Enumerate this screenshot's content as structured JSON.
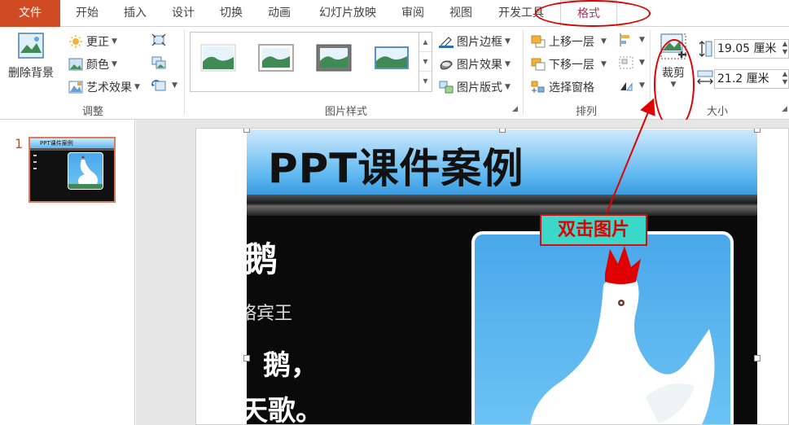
{
  "tabs": [
    {
      "id": "file",
      "label": "文件"
    },
    {
      "id": "home",
      "label": "开始"
    },
    {
      "id": "insert",
      "label": "插入"
    },
    {
      "id": "design",
      "label": "设计"
    },
    {
      "id": "transitions",
      "label": "切换"
    },
    {
      "id": "animations",
      "label": "动画"
    },
    {
      "id": "slideshow",
      "label": "幻灯片放映"
    },
    {
      "id": "review",
      "label": "审阅"
    },
    {
      "id": "view",
      "label": "视图"
    },
    {
      "id": "developer",
      "label": "开发工具"
    },
    {
      "id": "format",
      "label": "格式"
    }
  ],
  "ribbon": {
    "adjust": {
      "remove_bg": "删除背景",
      "corrections": "更正",
      "color": "颜色",
      "artistic": "艺术效果",
      "label": "调整"
    },
    "styles": {
      "border": "图片边框",
      "effects": "图片效果",
      "layout": "图片版式",
      "label": "图片样式"
    },
    "arrange": {
      "bring_forward": "上移一层",
      "send_backward": "下移一层",
      "selection_pane": "选择窗格",
      "label": "排列"
    },
    "size": {
      "crop": "裁剪",
      "height": "19.05 厘米",
      "width": "21.2 厘米",
      "label": "大小"
    }
  },
  "slides": {
    "number": "1",
    "thumb_title": "PPT课件案例"
  },
  "slide": {
    "title": "PPT课件案例",
    "poem_title": "鹅",
    "author": "骆宾王",
    "line1": "，鹅，",
    "line2": "天歌。"
  },
  "annotation": {
    "callout": "双击图片"
  },
  "colors": {
    "file_tab": "#d04a24",
    "format_tab_text": "#b0305a",
    "annotation_red": "#e00000",
    "callout_bg": "#3ad8c8"
  }
}
